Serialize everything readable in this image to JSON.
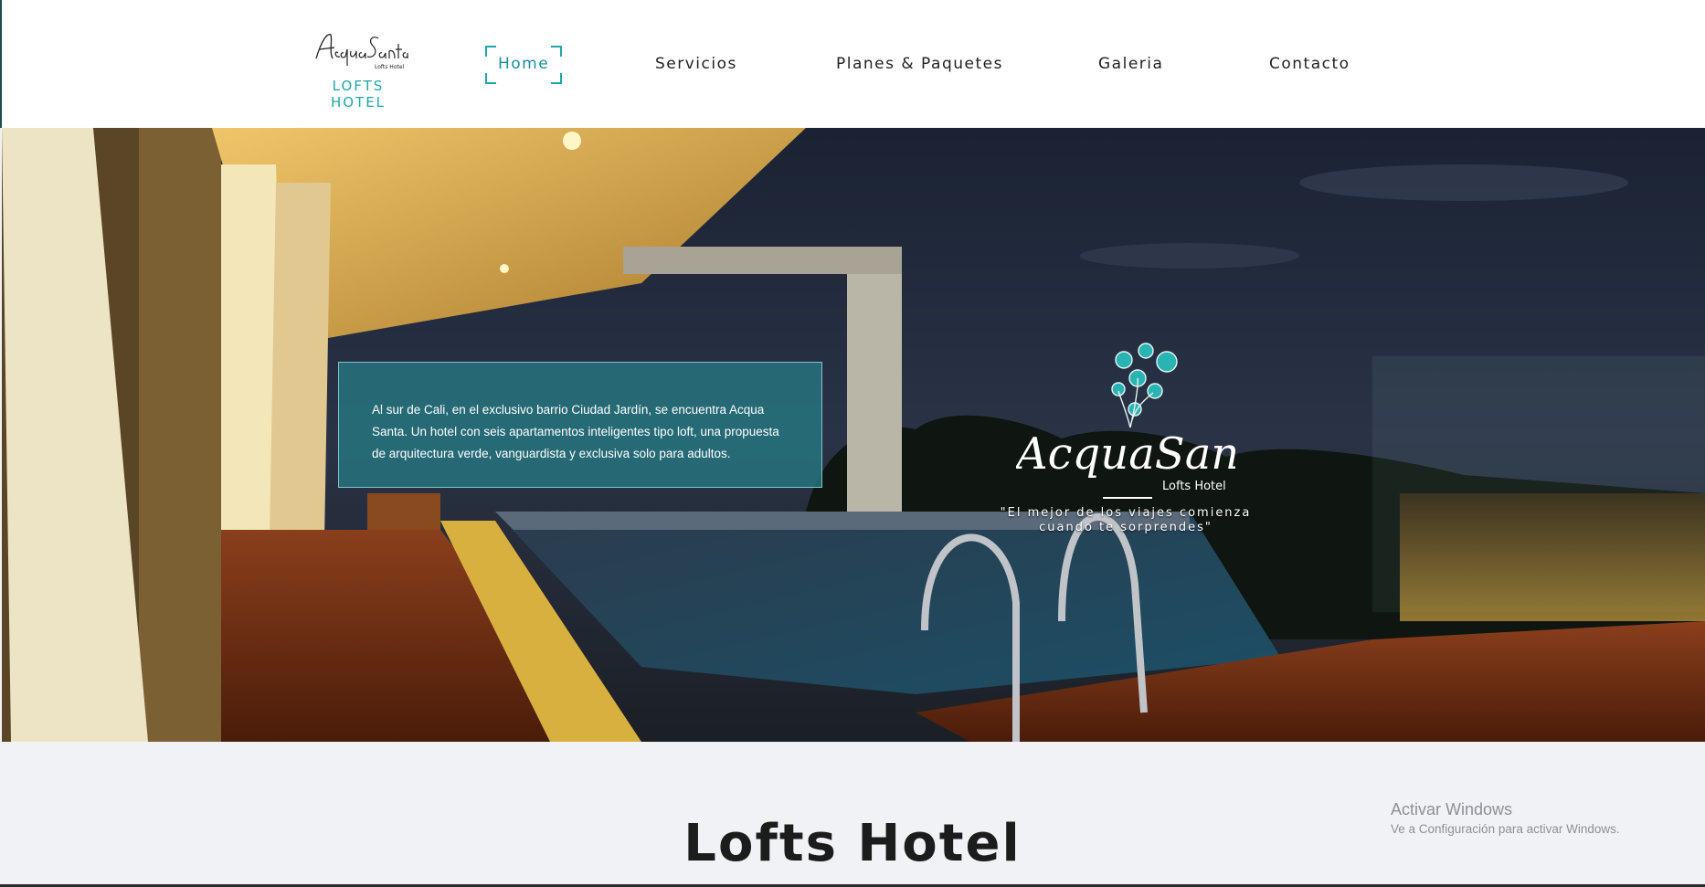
{
  "brand": {
    "logo_script": "Acqua Santa",
    "logo_small": "Lofts Hotel",
    "logo_sub": "LOFTS HOTEL"
  },
  "nav": {
    "items": [
      {
        "label": "Home",
        "active": true
      },
      {
        "label": "Servicios",
        "active": false
      },
      {
        "label": "Planes & Paquetes",
        "active": false
      },
      {
        "label": "Galeria",
        "active": false
      },
      {
        "label": "Contacto",
        "active": false
      }
    ]
  },
  "hero": {
    "description": "Al sur de Cali, en el exclusivo barrio Ciudad Jardín, se encuentra Acqua Santa. Un hotel con seis apartamentos inteligentes tipo loft, una propuesta de arquitectura verde, vanguardista y exclusiva solo para adultos.",
    "logo_script": "AcquaSanta",
    "logo_small": "Lofts Hotel",
    "quote_line1": "\"El mejor de los viajes comienza",
    "quote_line2": "cuando te sorprendes\""
  },
  "section": {
    "title": "Lofts Hotel"
  },
  "watermark": {
    "title": "Activar Windows",
    "subtitle": "Ve a Configuración para activar Windows."
  },
  "colors": {
    "accent": "#1fa7a7",
    "info_box": "#267680",
    "section_bg": "#f1f2f6"
  }
}
